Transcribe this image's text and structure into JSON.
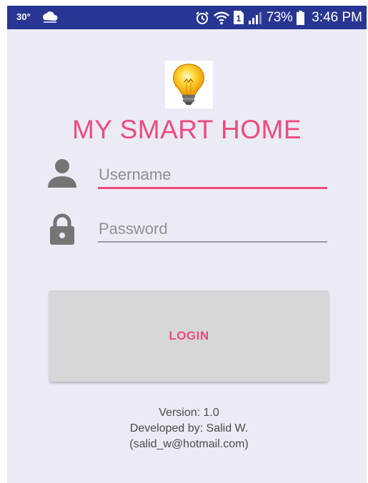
{
  "status_bar": {
    "temperature": "30°",
    "battery_percent": "73%",
    "time": "3:46 PM",
    "sim_slot": "1",
    "icons": [
      "weather-icon",
      "alarm-icon",
      "wifi-icon",
      "sim-icon",
      "signal-icon",
      "battery-icon"
    ],
    "background_color": "#283593"
  },
  "app": {
    "logo_icon": "light-bulb-icon",
    "title": "MY SMART HOME",
    "accent_color": "#ef4a7d"
  },
  "form": {
    "username": {
      "placeholder": "Username",
      "value": "",
      "icon": "person-icon"
    },
    "password": {
      "placeholder": "Password",
      "value": "",
      "icon": "lock-icon"
    },
    "login_label": "LOGIN"
  },
  "footer": {
    "version": "Version: 1.0",
    "developer": "Developed by: Salid W.",
    "email": "(salid_w@hotmail.com)"
  }
}
